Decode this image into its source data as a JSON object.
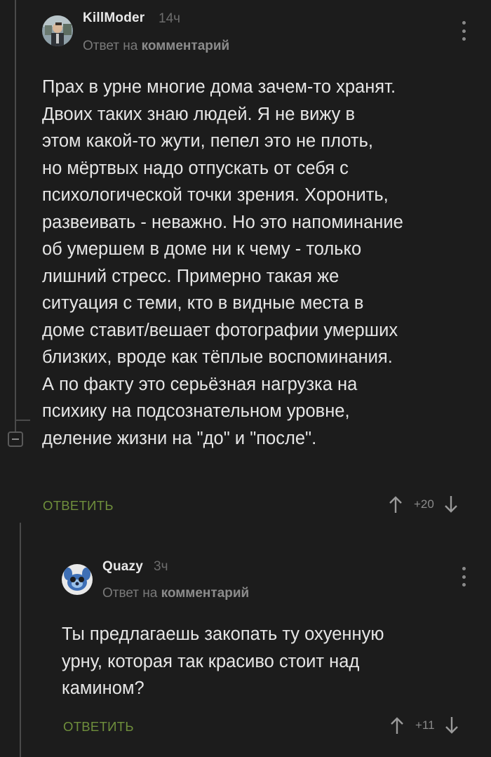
{
  "comments": [
    {
      "author": "KillModer",
      "time": "14ч",
      "reply_prefix": "Ответ на",
      "reply_link": "комментарий",
      "text": "Прах в урне многие дома зачем-то хранят.\nДвоих таких знаю людей. Я не вижу в\nэтом какой-то жути, пепел это не плоть,\nно мёртвых надо отпускать от себя с\nпсихологической точки зрения. Хоронить,\nразвеивать - неважно. Но это напоминание\nоб умершем в доме ни к чему - только\nлишний стресс. Примерно такая же\nситуация с теми, кто в видные места в\nдоме ставит/вешает фотографии умерших\nблизких, вроде как тёплые воспоминания.\nА по факту это серьёзная нагрузка на\nпсихику на подсознательном уровне,\nделение жизни на \"до\" и \"после\".",
      "reply_label": "ОТВЕТИТЬ",
      "rating": "+20"
    },
    {
      "author": "Quazy",
      "time": "3ч",
      "reply_prefix": "Ответ на",
      "reply_link": "комментарий",
      "text": "Ты предлагаешь закопать ту охуенную\nурну, которая так красиво стоит над\nкамином?",
      "reply_label": "ОТВЕТИТЬ",
      "rating": "+11"
    }
  ],
  "colors": {
    "background": "#1c1c1c",
    "accent": "#6f8f3c",
    "text": "#e6e6e6",
    "muted": "#7a7a7a"
  },
  "icons": {
    "menu": "kebab-menu-icon",
    "upvote": "arrow-up-icon",
    "downvote": "arrow-down-icon",
    "collapse": "collapse-thread-icon"
  }
}
